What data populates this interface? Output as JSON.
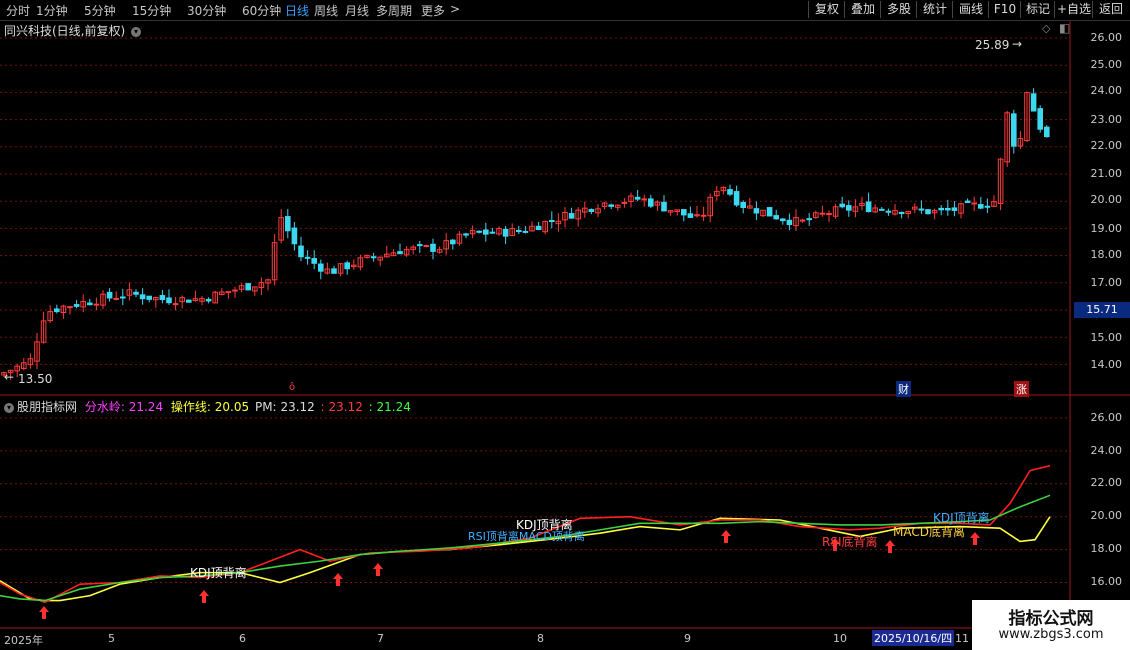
{
  "tabs": [
    "分时",
    "1分钟",
    "5分钟",
    "15分钟",
    "30分钟",
    "60分钟",
    "日线",
    "周线",
    "月线",
    "多周期",
    "更多"
  ],
  "active_tab": "日线",
  "more_arrow": ">",
  "tools": [
    "复权",
    "叠加",
    "多股",
    "统计",
    "画线",
    "F10",
    "标记",
    "+自选",
    "返回"
  ],
  "stock_title": "同兴科技(日线,前复权)",
  "price_axis": [
    "26.00",
    "25.00",
    "24.00",
    "23.00",
    "22.00",
    "21.00",
    "20.00",
    "19.00",
    "18.00",
    "17.00",
    "16.00",
    "15.00",
    "14.00"
  ],
  "current_price_tag": "15.71",
  "high_label": "25.89",
  "low_label": "13.50",
  "markers": {
    "cai": "财",
    "zhang": "涨",
    "small": "ô"
  },
  "indicator": {
    "name": "股朋指标网",
    "fsl_label": "分水岭:",
    "fsl_value": "21.24",
    "czx_label": "操作线:",
    "czx_value": "20.05",
    "pm_label": "PM:",
    "pm_value": "23.12",
    "v2": ": 23.12",
    "v3": ": 21.24"
  },
  "ind_axis": [
    "26.00",
    "24.00",
    "22.00",
    "20.00",
    "18.00",
    "16.00"
  ],
  "annotations": {
    "kdj1": "KDJ顶背离",
    "kdj2": "KDJ顶背离",
    "rsi_mix": "RSI顶背离MACD顶背离",
    "kdj3": "KDJ顶背离",
    "rsi_bottom": "RSI底背离",
    "macd_bottom": "MACD底背离"
  },
  "date_axis": [
    "2025年",
    "5",
    "6",
    "7",
    "8",
    "9",
    "10",
    "2025/10/16/四",
    "11"
  ],
  "watermark": {
    "line1": "指标公式网",
    "line2": "www.zbgs3.com"
  },
  "colors": {
    "up": "#ff3c3c",
    "down": "#3cd8f0",
    "grid": "#7a1010",
    "accent": "#3aa0ff"
  }
}
